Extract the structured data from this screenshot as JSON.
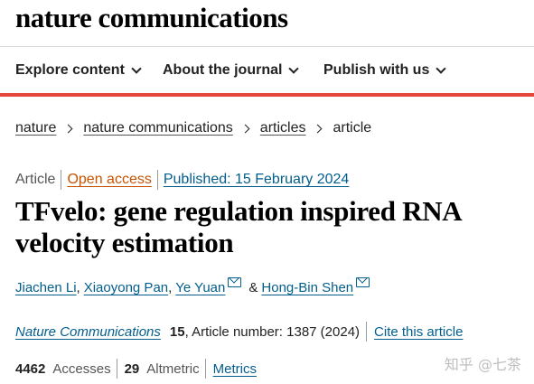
{
  "site": {
    "logo": "nature communications"
  },
  "nav": {
    "items": [
      {
        "label": "Explore content"
      },
      {
        "label": "About the journal"
      },
      {
        "label": "Publish with us"
      }
    ]
  },
  "breadcrumb": {
    "items": [
      {
        "label": "nature"
      },
      {
        "label": "nature communications"
      },
      {
        "label": "articles"
      }
    ],
    "current": "article"
  },
  "article": {
    "type": "Article",
    "access": "Open access",
    "published": "Published: 15 February 2024",
    "title": "TFvelo: gene regulation inspired RNA velocity estimation",
    "authors": [
      {
        "name": "Jiachen Li"
      },
      {
        "name": "Xiaoyong Pan"
      },
      {
        "name": "Ye Yuan"
      },
      {
        "name": "Hong-Bin Shen"
      }
    ],
    "author_separators": {
      "comma": ",",
      "and": "&"
    },
    "citation": {
      "journal": "Nature Communications",
      "volume": "15",
      "details": ", Article number: 1387 (2024)",
      "cite_label": "Cite this article"
    },
    "metrics": {
      "accesses_value": "4462",
      "accesses_label": "Accesses",
      "altmetric_value": "29",
      "altmetric_label": "Altmetric",
      "metrics_link": "Metrics"
    }
  },
  "watermark": "知乎 @七茶",
  "colors": {
    "accent_red": "#e4463b",
    "link_blue": "#025e8d",
    "open_access_orange": "#c65301"
  }
}
